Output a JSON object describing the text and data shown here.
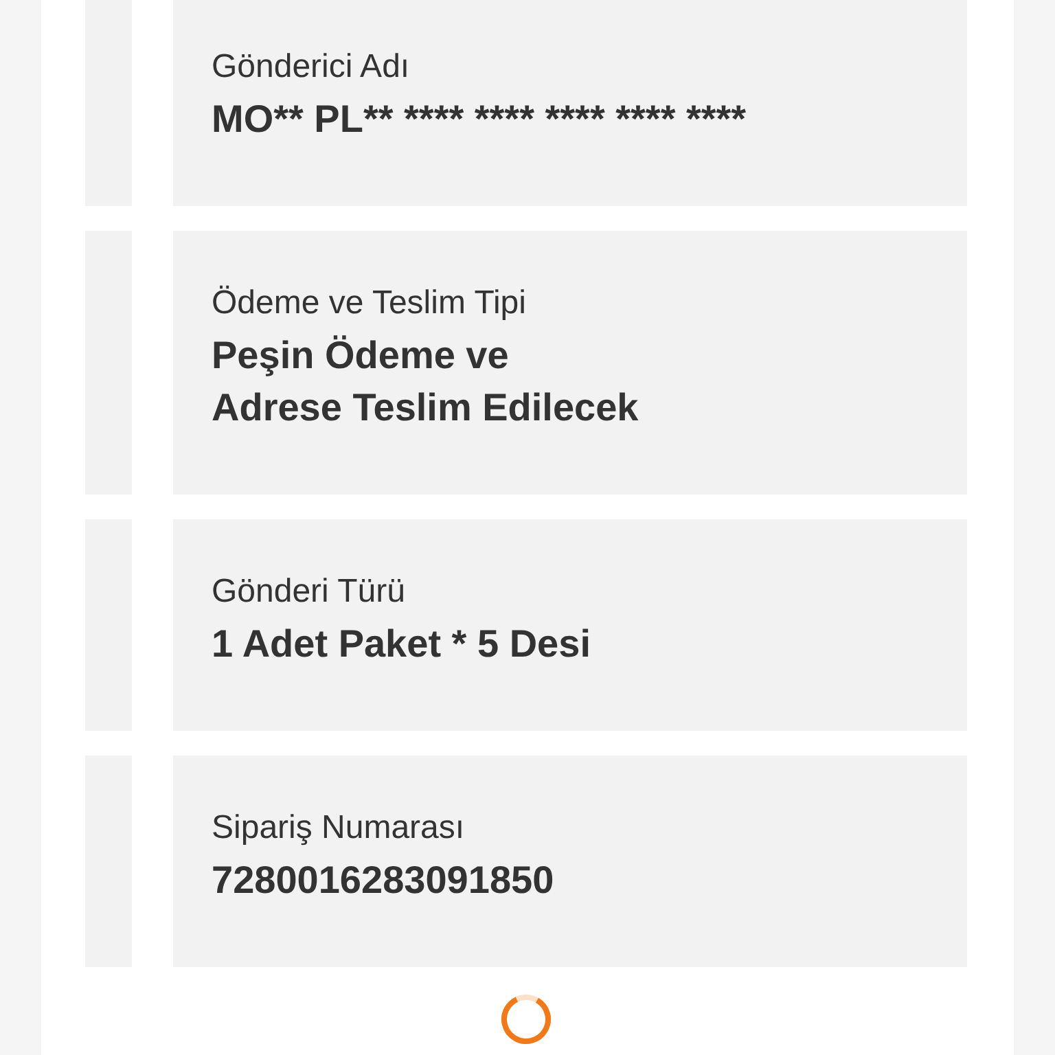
{
  "fields": [
    {
      "label": "Gönderici Adı",
      "value": "MO** PL** **** **** **** **** ****"
    },
    {
      "label": "Ödeme ve Teslim Tipi",
      "value": "Peşin Ödeme ve\nAdrese Teslim Edilecek"
    },
    {
      "label": "Gönderi Türü",
      "value": "1 Adet Paket * 5 Desi"
    },
    {
      "label": "Sipariş Numarası",
      "value": "7280016283091850"
    }
  ],
  "loading": true
}
